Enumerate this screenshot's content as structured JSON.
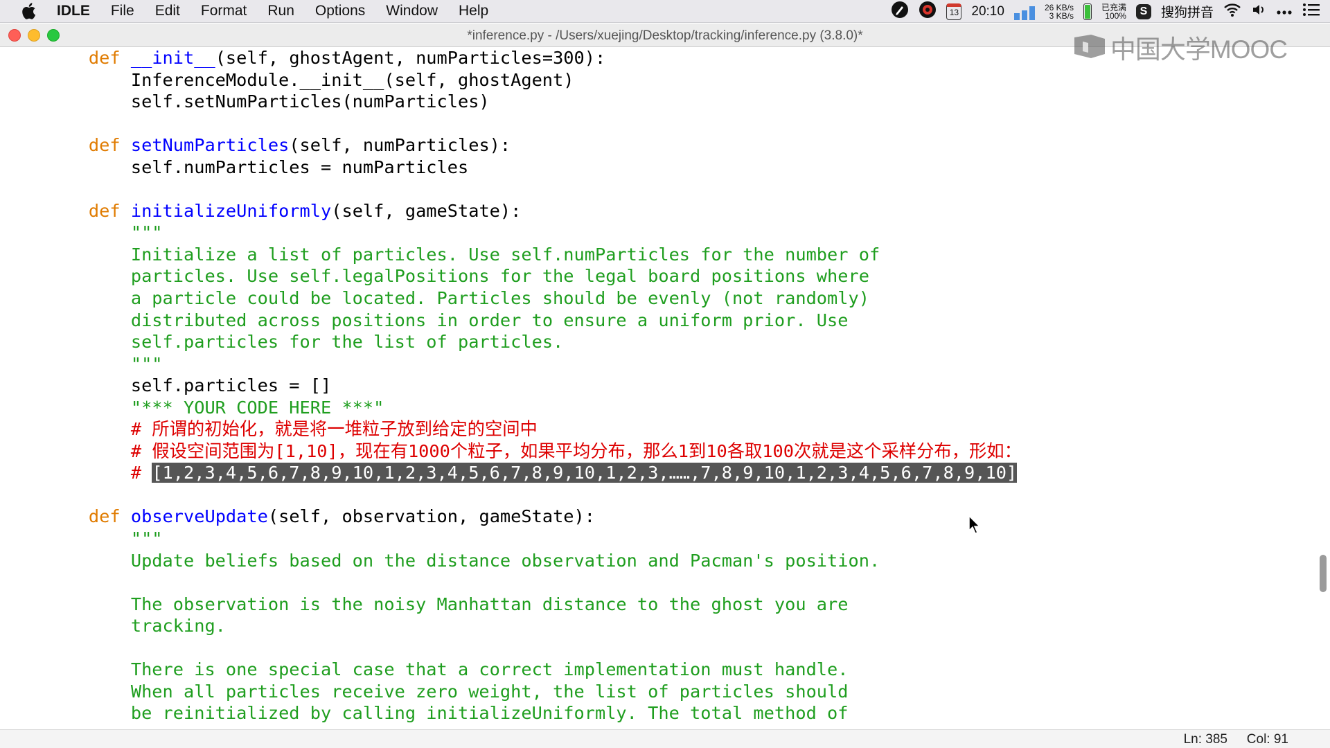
{
  "menubar": {
    "app_name": "IDLE",
    "menus": [
      "File",
      "Edit",
      "Format",
      "Run",
      "Options",
      "Window",
      "Help"
    ],
    "status": {
      "calendar_day": "13",
      "clock": "20:10",
      "net_up": "26 KB/s",
      "net_down": "3 KB/s",
      "battery_status": "已充满",
      "battery_percent": "100%",
      "input_method": "搜狗拼音"
    }
  },
  "window": {
    "title": "*inference.py - /Users/xuejing/Desktop/tracking/inference.py (3.8.0)*"
  },
  "watermark": {
    "text": "中国大学MOOC"
  },
  "editor": {
    "lines": [
      [
        {
          "t": "    "
        },
        {
          "c": "kw",
          "t": "def"
        },
        {
          "t": " "
        },
        {
          "c": "def",
          "t": "__init__"
        },
        {
          "t": "(self, ghostAgent, numParticles=300):"
        }
      ],
      [
        {
          "t": "        InferenceModule.__init__(self, ghostAgent)"
        }
      ],
      [
        {
          "t": "        self.setNumParticles(numParticles)"
        }
      ],
      [
        {
          "t": ""
        }
      ],
      [
        {
          "t": "    "
        },
        {
          "c": "kw",
          "t": "def"
        },
        {
          "t": " "
        },
        {
          "c": "def",
          "t": "setNumParticles"
        },
        {
          "t": "(self, numParticles):"
        }
      ],
      [
        {
          "t": "        self.numParticles = numParticles"
        }
      ],
      [
        {
          "t": ""
        }
      ],
      [
        {
          "t": "    "
        },
        {
          "c": "kw",
          "t": "def"
        },
        {
          "t": " "
        },
        {
          "c": "def",
          "t": "initializeUniformly"
        },
        {
          "t": "(self, gameState):"
        }
      ],
      [
        {
          "t": "        "
        },
        {
          "c": "str",
          "t": "\"\"\""
        }
      ],
      [
        {
          "t": "        "
        },
        {
          "c": "str",
          "t": "Initialize a list of particles. Use self.numParticles for the number of"
        }
      ],
      [
        {
          "t": "        "
        },
        {
          "c": "str",
          "t": "particles. Use self.legalPositions for the legal board positions where"
        }
      ],
      [
        {
          "t": "        "
        },
        {
          "c": "str",
          "t": "a particle could be located. Particles should be evenly (not randomly)"
        }
      ],
      [
        {
          "t": "        "
        },
        {
          "c": "str",
          "t": "distributed across positions in order to ensure a uniform prior. Use"
        }
      ],
      [
        {
          "t": "        "
        },
        {
          "c": "str",
          "t": "self.particles for the list of particles."
        }
      ],
      [
        {
          "t": "        "
        },
        {
          "c": "str",
          "t": "\"\"\""
        }
      ],
      [
        {
          "t": "        self.particles = []"
        }
      ],
      [
        {
          "t": "        "
        },
        {
          "c": "str",
          "t": "\"*** YOUR CODE HERE ***\""
        }
      ],
      [
        {
          "t": "        "
        },
        {
          "c": "cmt",
          "t": "# 所谓的初始化，就是将一堆粒子放到给定的空间中"
        }
      ],
      [
        {
          "t": "        "
        },
        {
          "c": "cmt",
          "t": "# 假设空间范围为[1,10]，现在有1000个粒子，如果平均分布，那么1到10各取100次就是这个采样分布，形如："
        }
      ],
      [
        {
          "t": "        "
        },
        {
          "c": "cmt",
          "t": "# "
        },
        {
          "c": "sel",
          "t": "[1,2,3,4,5,6,7,8,9,10,1,2,3,4,5,6,7,8,9,10,1,2,3,……,7,8,9,10,1,2,3,4,5,6,7,8,9,10]"
        }
      ],
      [
        {
          "t": ""
        }
      ],
      [
        {
          "t": "    "
        },
        {
          "c": "kw",
          "t": "def"
        },
        {
          "t": " "
        },
        {
          "c": "def",
          "t": "observeUpdate"
        },
        {
          "t": "(self, observation, gameState):"
        }
      ],
      [
        {
          "t": "        "
        },
        {
          "c": "str",
          "t": "\"\"\""
        }
      ],
      [
        {
          "t": "        "
        },
        {
          "c": "str",
          "t": "Update beliefs based on the distance observation and Pacman's position."
        }
      ],
      [
        {
          "t": ""
        }
      ],
      [
        {
          "t": "        "
        },
        {
          "c": "str",
          "t": "The observation is the noisy Manhattan distance to the ghost you are"
        }
      ],
      [
        {
          "t": "        "
        },
        {
          "c": "str",
          "t": "tracking."
        }
      ],
      [
        {
          "t": ""
        }
      ],
      [
        {
          "t": "        "
        },
        {
          "c": "str",
          "t": "There is one special case that a correct implementation must handle."
        }
      ],
      [
        {
          "t": "        "
        },
        {
          "c": "str",
          "t": "When all particles receive zero weight, the list of particles should"
        }
      ],
      [
        {
          "t": "        "
        },
        {
          "c": "str",
          "t": "be reinitialized by calling initializeUniformly. The total method of"
        }
      ]
    ]
  },
  "statusbar": {
    "line": "Ln: 385",
    "col": "Col: 91"
  }
}
